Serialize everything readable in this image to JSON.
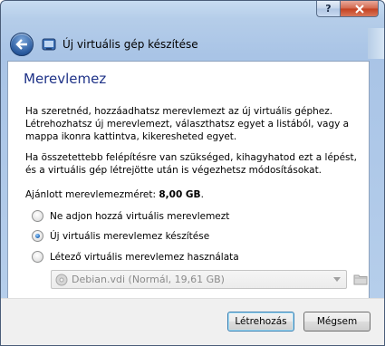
{
  "window": {
    "title": "Új virtuális gép készítése",
    "help_glyph": "?"
  },
  "page": {
    "heading": "Merevlemez",
    "paragraph1": "Ha szeretnéd, hozzáadhatsz merevlemezt az új virtuális géphez. Létrehozhatsz új merevlemezt, választhatsz egyet a listából, vagy a mappa ikonra kattintva, kikeresheted egyet.",
    "paragraph2": "Ha összetettebb felépítésre van szükséged, kihagyhatod ezt a lépést, és a virtuális gép létrejötte után is végezhetsz módosításokat.",
    "recommended_label": "Ajánlott merevlemezméret:",
    "recommended_value": "8,00 GB",
    "recommended_suffix": "."
  },
  "options": [
    {
      "label": "Ne adjon hozzá virtuális merevlemezt",
      "checked": false
    },
    {
      "label": "Új virtuális merevlemez készítése",
      "checked": true
    },
    {
      "label": "Létező virtuális merevlemez használata",
      "checked": false
    }
  ],
  "disk_select": {
    "value": "Debian.vdi (Normál, 19,61 GB)",
    "enabled": false
  },
  "buttons": {
    "create": "Létrehozás",
    "cancel": "Mégsem"
  }
}
